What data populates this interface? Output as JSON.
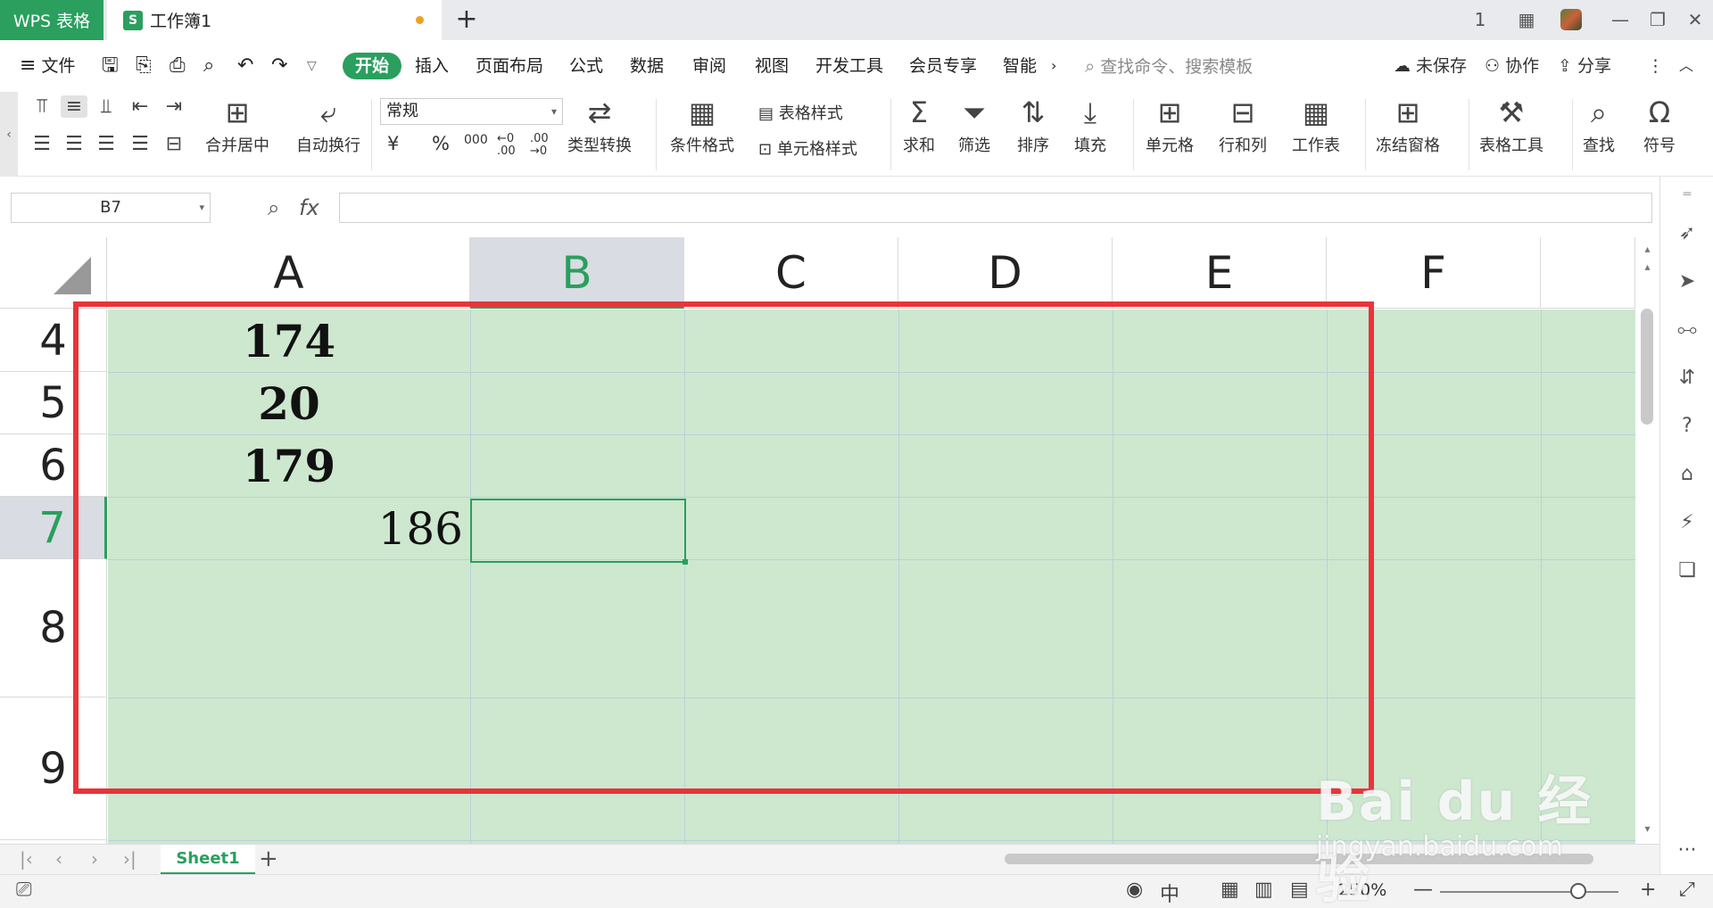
{
  "titlebar": {
    "app_name": "WPS 表格",
    "doc_icon": "S",
    "doc_name": "工作簿1",
    "new_tab": "+",
    "window_controls": [
      "1",
      "▦",
      "—",
      "❐",
      "✕"
    ]
  },
  "menubar": {
    "file": "文件",
    "tabs": [
      "开始",
      "插入",
      "页面布局",
      "公式",
      "数据",
      "审阅",
      "视图",
      "开发工具",
      "会员专享",
      "智能"
    ],
    "more": "›",
    "search_placeholder": "查找命令、搜索模板",
    "unsaved": "未保存",
    "collab": "协作",
    "share": "分享"
  },
  "ribbon": {
    "merge_center": "合并居中",
    "wrap_text": "自动换行",
    "number_format": "常规",
    "currency": "¥",
    "percent": "%",
    "thousands": "000",
    "dec_increase": "←0 .00",
    "dec_decrease": ".00 →0",
    "type_convert": "类型转换",
    "cond_format": "条件格式",
    "table_style": "表格样式",
    "cell_style": "单元格样式",
    "sum": "求和",
    "filter": "筛选",
    "sort": "排序",
    "fill": "填充",
    "cell": "单元格",
    "row_col": "行和列",
    "worksheet": "工作表",
    "freeze": "冻结窗格",
    "table_tools": "表格工具",
    "find": "查找",
    "symbol": "符号"
  },
  "formulabar": {
    "name_box": "B7",
    "fx": "fx",
    "formula": ""
  },
  "grid": {
    "columns": [
      "A",
      "B",
      "C",
      "D",
      "E",
      "F"
    ],
    "selected_column": "B",
    "rows": [
      "4",
      "5",
      "6",
      "7",
      "8",
      "9"
    ],
    "selected_row": "7",
    "cells": {
      "A4": "174",
      "A5": "20",
      "A6": "179",
      "A7": "186"
    }
  },
  "sheets": {
    "tabs": [
      "Sheet1"
    ],
    "active": "Sheet1",
    "add": "+"
  },
  "statusbar": {
    "zoom": "250%",
    "zoom_out": "—",
    "zoom_in": "+"
  },
  "watermark": {
    "main": "Bai du 经验",
    "sub": "jingyan.baidu.com"
  },
  "colors": {
    "accent": "#2a9f5e",
    "cell_fill": "#cde8cf",
    "highlight_box": "#e8343a"
  }
}
